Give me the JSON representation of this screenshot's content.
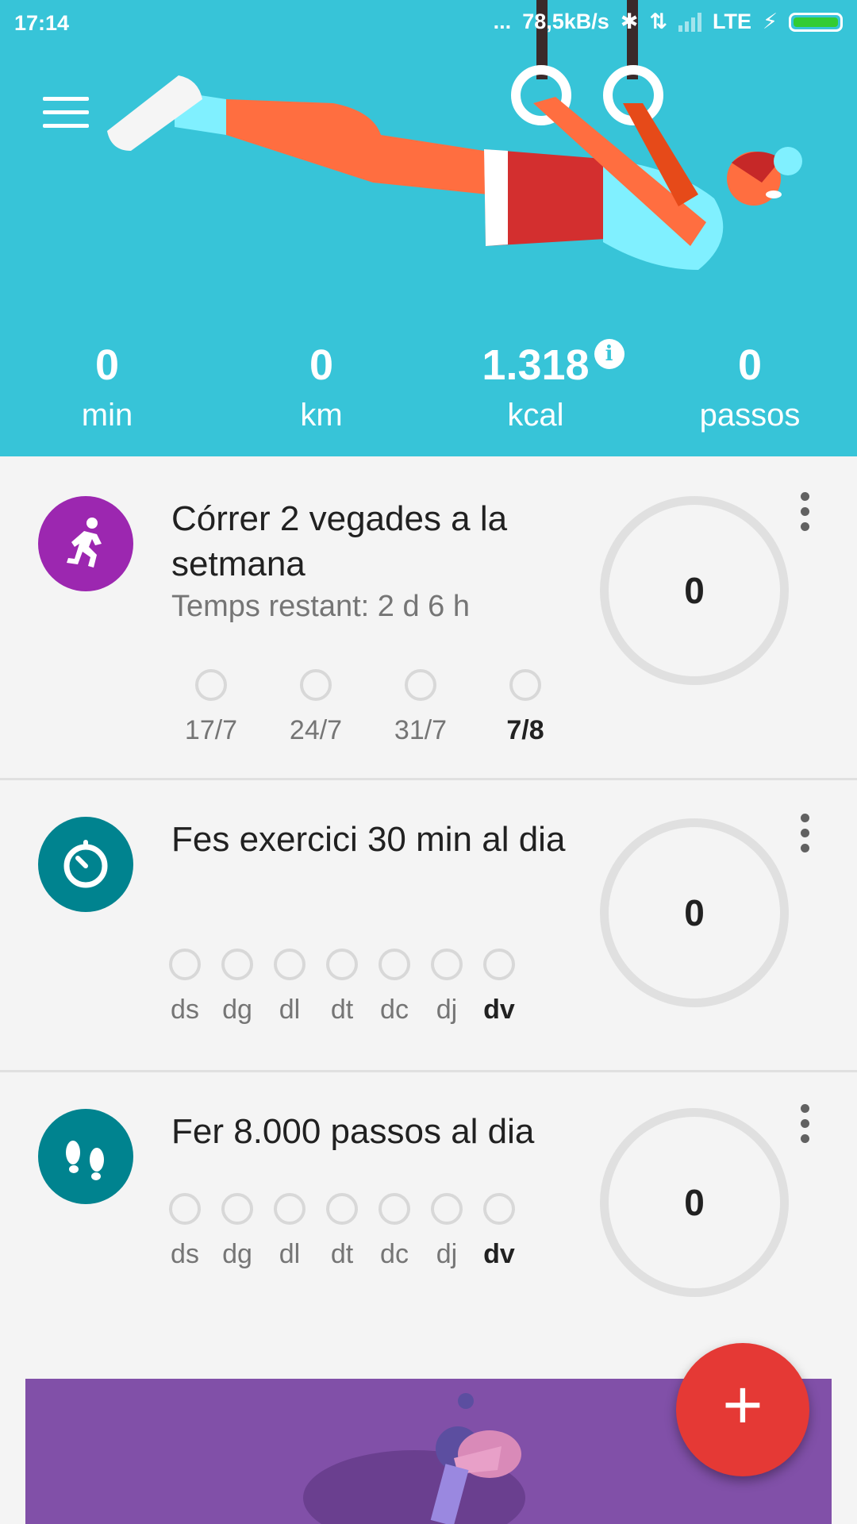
{
  "status_bar": {
    "time": "17:14",
    "dots": "...",
    "network_speed": "78,5kB/s",
    "network": "LTE"
  },
  "header": {
    "background_color": "#37c4d8",
    "menu_icon": "hamburger-menu-icon"
  },
  "stats": [
    {
      "value": "0",
      "label": "min"
    },
    {
      "value": "0",
      "label": "km"
    },
    {
      "value": "1.318",
      "label": "kcal",
      "info_icon": "info-icon"
    },
    {
      "value": "0",
      "label": "passos"
    }
  ],
  "goals": [
    {
      "icon": "running-person-icon",
      "icon_color": "#9c27b0",
      "title": "Córrer 2 vegades a la setmana",
      "subtitle": "Temps restant: 2 d 6 h",
      "progress": "0",
      "days": [
        "17/7",
        "24/7",
        "31/7",
        "7/8"
      ],
      "current_day": "7/8"
    },
    {
      "icon": "stopwatch-icon",
      "icon_color": "#00838f",
      "title": "Fes exercici 30 min al dia",
      "progress": "0",
      "days": [
        "ds",
        "dg",
        "dl",
        "dt",
        "dc",
        "dj",
        "dv"
      ],
      "current_day": "dv"
    },
    {
      "icon": "footsteps-icon",
      "icon_color": "#00838f",
      "title": "Fer 8.000 passos al dia",
      "progress": "0",
      "days": [
        "ds",
        "dg",
        "dl",
        "dt",
        "dc",
        "dj",
        "dv"
      ],
      "current_day": "dv"
    }
  ],
  "fab": {
    "label": "+",
    "color": "#e53935"
  },
  "promo": {
    "color": "#8150a8"
  }
}
